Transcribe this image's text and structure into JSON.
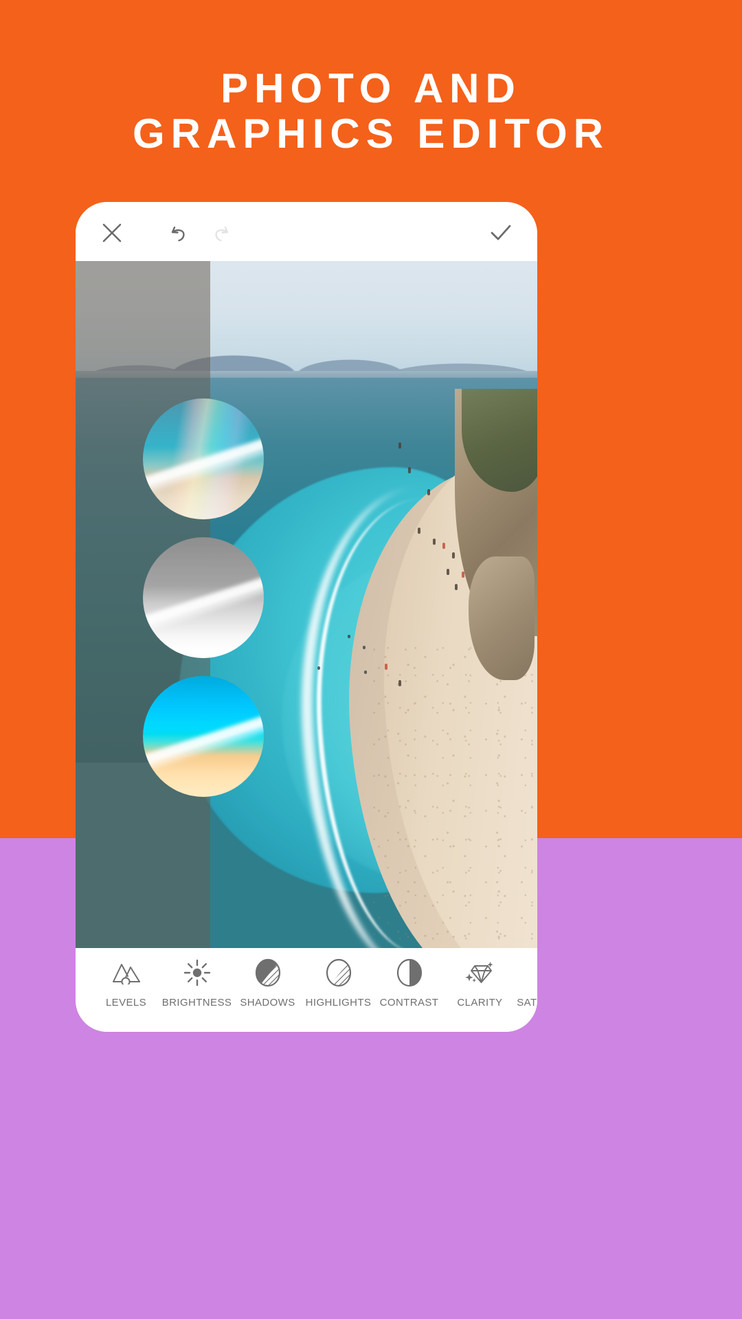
{
  "theme": {
    "background_top": "#F4611B",
    "background_bottom": "#CE84E2",
    "card_background": "#FFFFFF",
    "icon_color": "#6F6F6F",
    "headline_color": "#FFFFFF"
  },
  "headline": {
    "line1": "Photo and",
    "line2": "Graphics Editor"
  },
  "app": {
    "toolbar": {
      "close_icon": "close-x-icon",
      "close_label": "Close",
      "undo_icon": "undo-arrow-icon",
      "undo_label": "Undo",
      "undo_state": "enabled",
      "redo_icon": "redo-arrow-icon",
      "redo_label": "Redo",
      "redo_state": "disabled",
      "done_icon": "checkmark-icon",
      "done_label": "Done"
    },
    "canvas": {
      "photo_description": "Aerial beach coastline with turquoise sea and sand",
      "before_after_split": "Left portion shows unedited original"
    },
    "filter_previews": [
      {
        "name": "rainbow-gradient-filter",
        "label": "Rainbow"
      },
      {
        "name": "black-and-white-filter",
        "label": "Black & White"
      },
      {
        "name": "vivid-saturation-filter",
        "label": "Vivid"
      }
    ],
    "tools": [
      {
        "label": "Levels",
        "icon": "mountain-levels-icon"
      },
      {
        "label": "Brightness",
        "icon": "sun-brightness-icon"
      },
      {
        "label": "Shadows",
        "icon": "filled-circle-shadows-icon"
      },
      {
        "label": "Highlights",
        "icon": "outlined-circle-highlights-icon"
      },
      {
        "label": "Contrast",
        "icon": "half-filled-circle-contrast-icon"
      },
      {
        "label": "Clarity",
        "icon": "diamond-sparkle-clarity-icon"
      },
      {
        "label": "Saturation",
        "icon": "saturation-icon"
      }
    ]
  }
}
